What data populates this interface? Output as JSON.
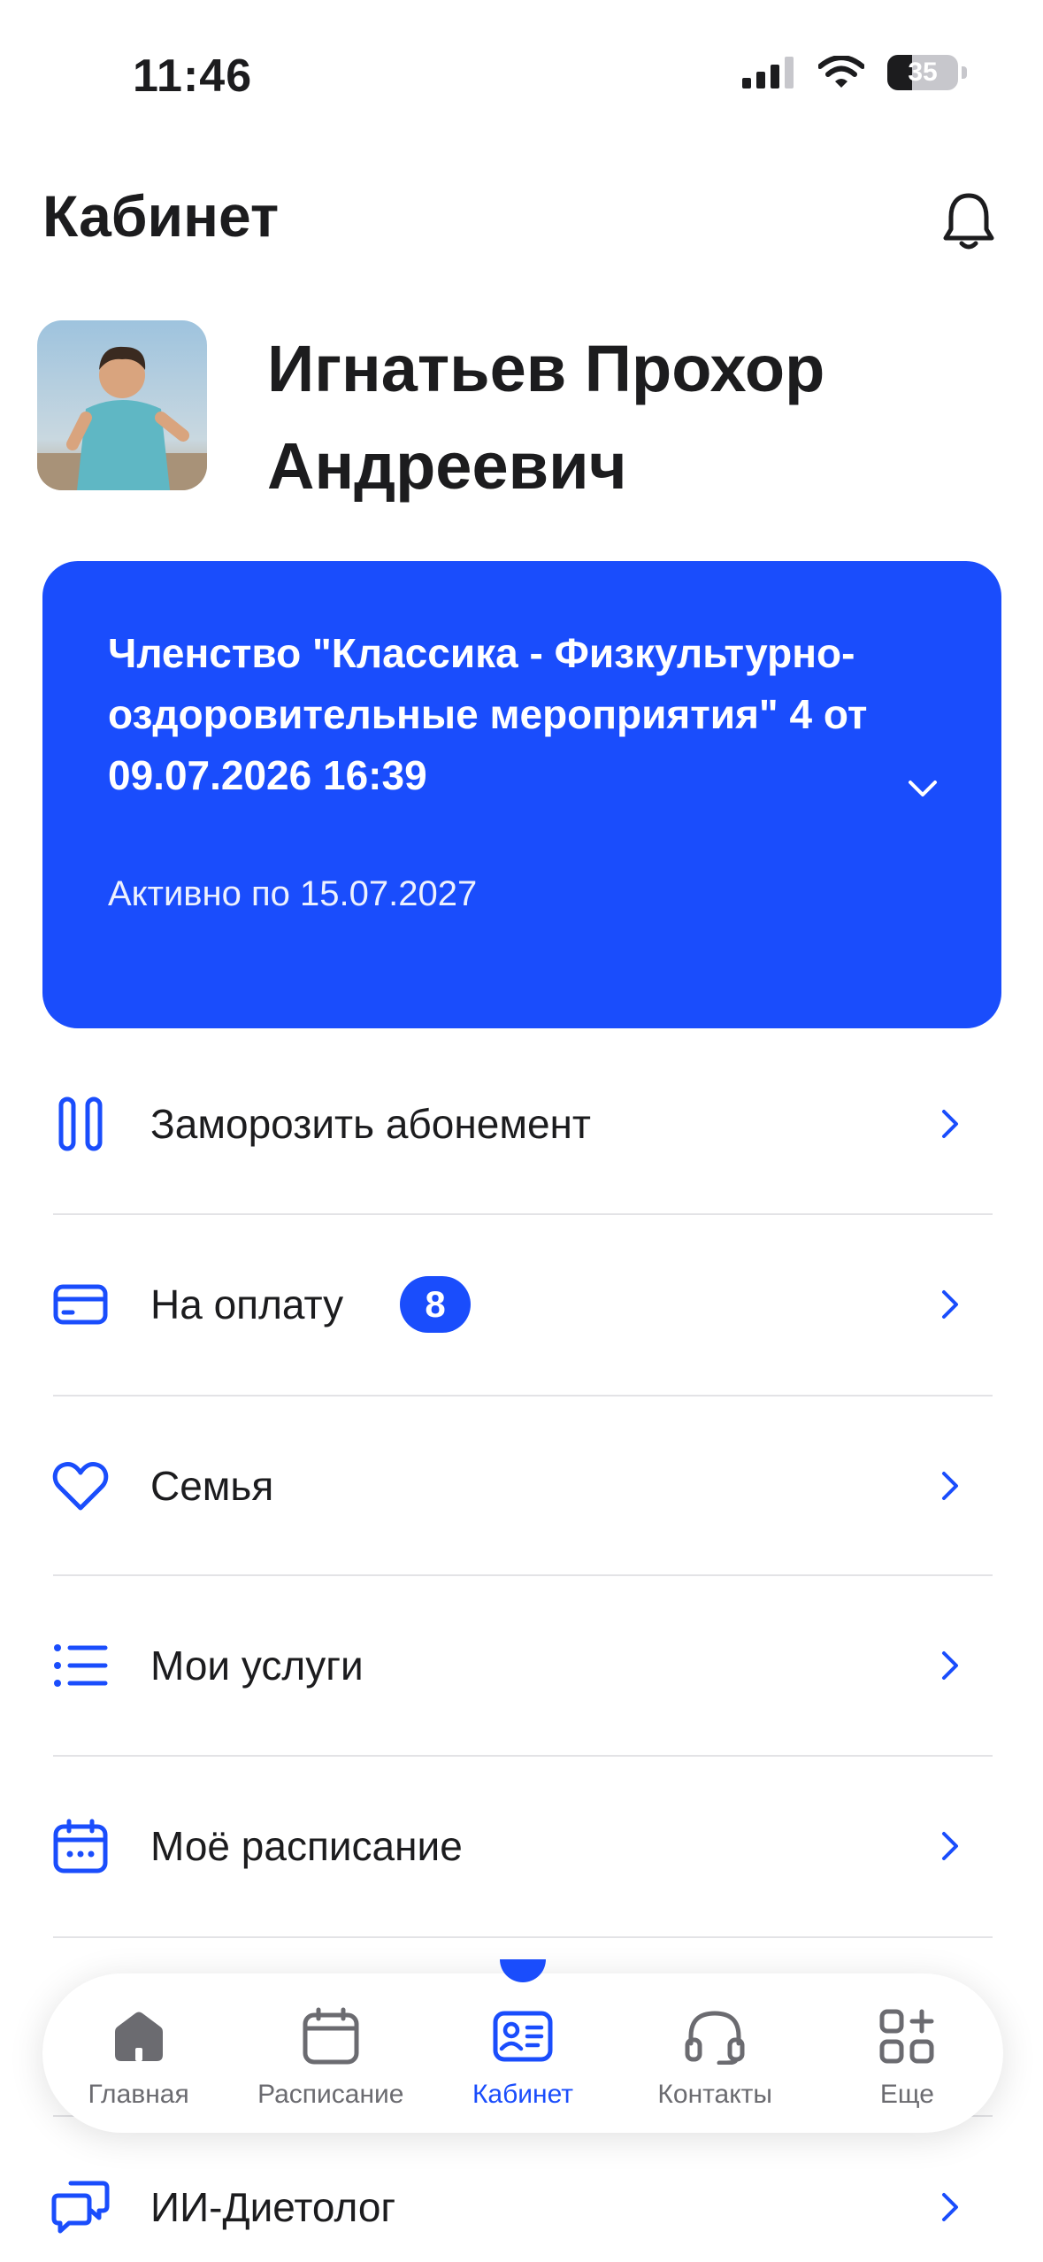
{
  "status_bar": {
    "time": "11:46",
    "battery": "35",
    "battery_level": 0.35
  },
  "header": {
    "title": "Кабинет",
    "bell_icon": "bell-icon"
  },
  "profile": {
    "name": "Игнатьев Прохор Андреевич",
    "avatar_icon": "avatar"
  },
  "membership": {
    "title": "Членство \"Классика - Физкультурно-оздоровительные мероприятия\" 4 от 09.07.2026 16:39",
    "status": "Активно по 15.07.2027",
    "chevron_icon": "chevron-down-icon"
  },
  "menu": {
    "items": [
      {
        "label": "Заморозить абонемент",
        "icon": "pause-icon"
      },
      {
        "label": "На оплату",
        "icon": "credit-card-icon",
        "badge": "8"
      },
      {
        "label": "Семья",
        "icon": "heart-icon"
      },
      {
        "label": "Мои услуги",
        "icon": "list-icon"
      },
      {
        "label": "Моё расписание",
        "icon": "calendar-icon"
      },
      {
        "label": "ИИ-Диетолог",
        "icon": "chat-bubbles-icon"
      }
    ]
  },
  "tab_bar": {
    "tabs": [
      {
        "label": "Главная",
        "icon": "home-icon"
      },
      {
        "label": "Расписание",
        "icon": "calendar-icon"
      },
      {
        "label": "Кабинет",
        "icon": "profile-card-icon",
        "active": true
      },
      {
        "label": "Контакты",
        "icon": "headphones-icon"
      },
      {
        "label": "Еще",
        "icon": "grid-plus-icon"
      }
    ]
  },
  "colors": {
    "accent": "#1a4dfc",
    "text": "#1c1c1e",
    "divider": "#e3e3e6",
    "tab_inactive": "#6b6b70"
  }
}
